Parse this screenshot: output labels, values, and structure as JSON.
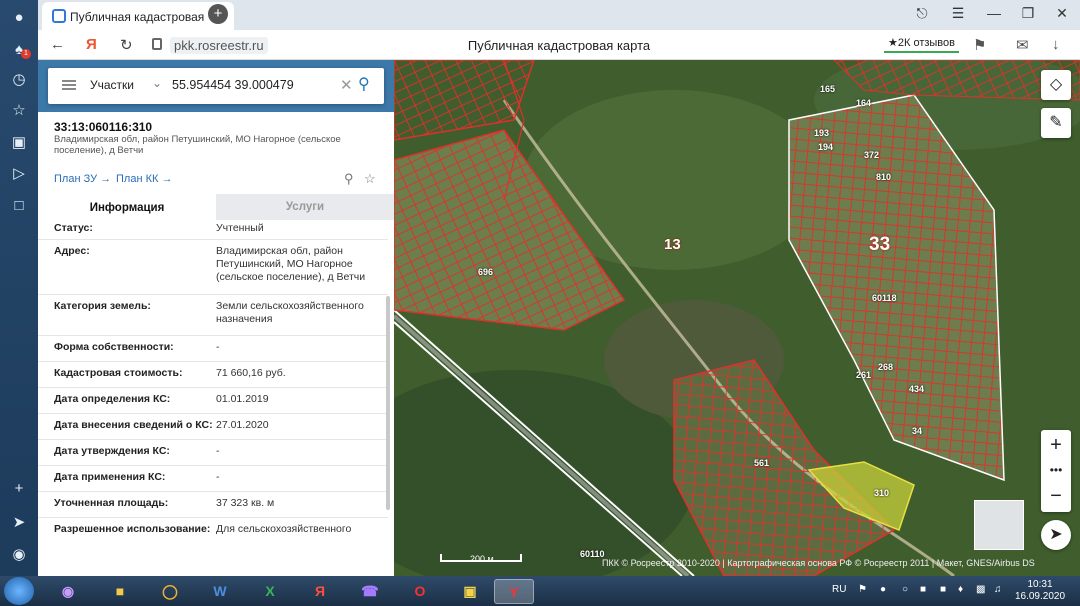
{
  "browser": {
    "tab_title": "Публичная кадастровая",
    "url": "pkk.rosreestr.ru",
    "page_title": "Публичная кадастровая карта",
    "reviews": "★2К отзывов"
  },
  "search": {
    "type": "Участки",
    "value": "55.954454 39.000479"
  },
  "parcel": {
    "number": "33:13:060116:310",
    "address": "Владимирская обл, район Петушинский, МО Нагорное (сельское поселение), д Ветчи",
    "plan_zu": "План ЗУ →",
    "plan_kk": "План КК →"
  },
  "tabs": {
    "info": "Информация",
    "services": "Услуги"
  },
  "attributes": [
    {
      "key": "Статус:",
      "value": "Учтенный"
    },
    {
      "key": "Адрес:",
      "value": "Владимирская обл, район Петушинский, МО Нагорное (сельское поселение), д Ветчи"
    },
    {
      "key": "Категория земель:",
      "value": "Земли сельскохозяйственного назначения"
    },
    {
      "key": "Форма собственности:",
      "value": "-"
    },
    {
      "key": "Кадастровая стоимость:",
      "value": "71 660,16 руб."
    },
    {
      "key": "Дата определения КС:",
      "value": "01.01.2019"
    },
    {
      "key": "Дата внесения сведений о КС:",
      "value": "27.01.2020"
    },
    {
      "key": "Дата утверждения КС:",
      "value": "-"
    },
    {
      "key": "Дата применения КС:",
      "value": "-"
    },
    {
      "key": "Уточненная площадь:",
      "value": "37 323 кв. м"
    },
    {
      "key": "Разрешенное использование:",
      "value": "Для сельскохозяйственного"
    }
  ],
  "map": {
    "scale": "200 м",
    "copyright": "ПКК © Росреестр 2010-2020 | Картографическая основа РФ © Росреестр 2011 | Макет, GNES/Airbus DS",
    "labels": {
      "l13": "13",
      "l33": "33",
      "l60118": "60118",
      "l60110": "60110",
      "l310": "310",
      "l696": "696",
      "l372": "372",
      "l810": "810",
      "l434": "434",
      "l561": "561",
      "l165": "165",
      "l164": "164",
      "l193": "193",
      "l194": "194",
      "l268": "268",
      "l261": "261",
      "l34": "34"
    }
  },
  "taskbar": {
    "lang": "RU",
    "time": "10:31",
    "date": "16.09.2020"
  }
}
